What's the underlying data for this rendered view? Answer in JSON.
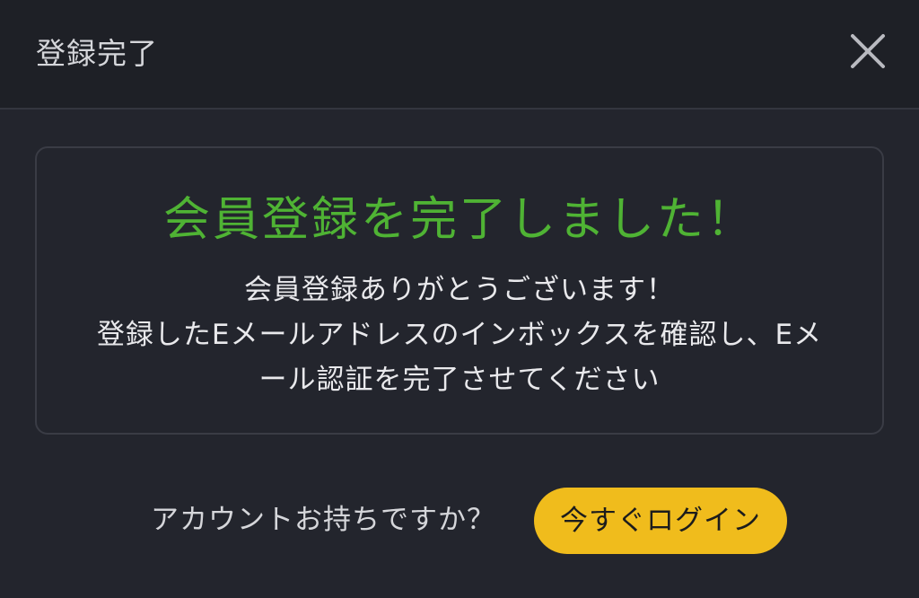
{
  "header": {
    "title": "登録完了",
    "close_icon": "close-icon"
  },
  "message": {
    "headline": "会員登録を完了しました！",
    "lines": [
      "会員登録ありがとうございます！",
      "登録したEメールアドレスのインボックスを確認し、Eメ",
      "ール認証を完了させてください"
    ]
  },
  "footer": {
    "question": "アカウントお持ちですか？",
    "login_label": "今すぐログイン"
  },
  "colors": {
    "background": "#23252d",
    "header_background": "#1e2026",
    "headline": "#4fb334",
    "button": "#f0bc1c",
    "text": "#e9e9ec"
  }
}
